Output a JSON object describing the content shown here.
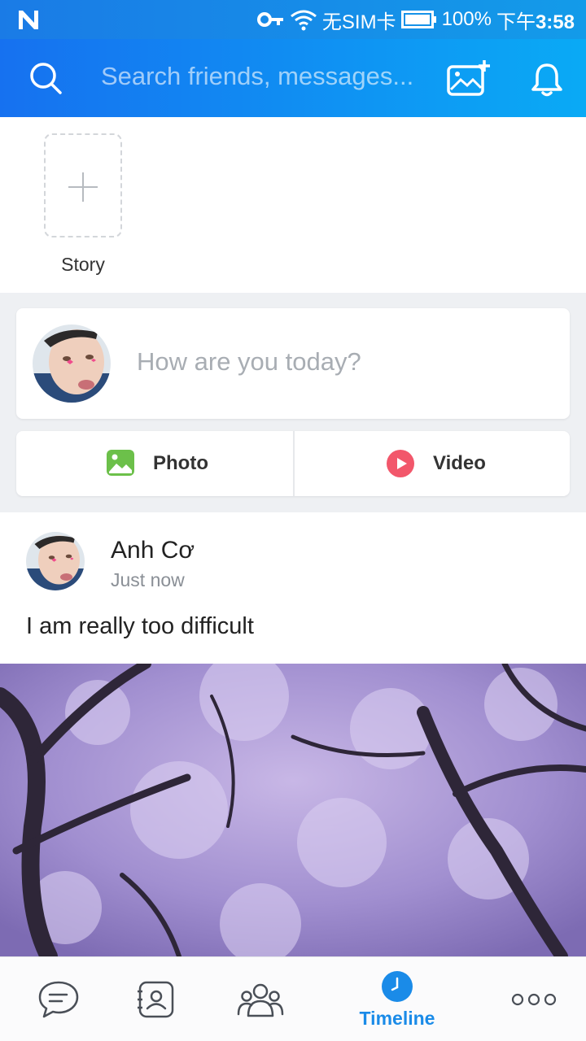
{
  "status_bar": {
    "sim_text": "无SIM卡",
    "battery": "100%",
    "time_prefix": "下午",
    "time": "3:58"
  },
  "header": {
    "search_placeholder": "Search friends, messages..."
  },
  "story": {
    "label": "Story"
  },
  "composer": {
    "placeholder": "How are you today?",
    "photo_label": "Photo",
    "video_label": "Video"
  },
  "post": {
    "author": "Anh Cơ",
    "time": "Just now",
    "text": "I am really too difficult"
  },
  "bottom_nav": {
    "items": [
      {
        "icon": "chat-icon",
        "active": false
      },
      {
        "icon": "contacts-icon",
        "active": false
      },
      {
        "icon": "groups-icon",
        "active": false
      },
      {
        "icon": "clock-icon",
        "label": "Timeline",
        "active": true
      },
      {
        "icon": "more-icon",
        "active": false
      }
    ]
  },
  "colors": {
    "header_start": "#1671f0",
    "header_end": "#0aaaf5",
    "accent": "#1a8be8",
    "photo_green": "#6cc04a",
    "video_red": "#f2576b"
  }
}
